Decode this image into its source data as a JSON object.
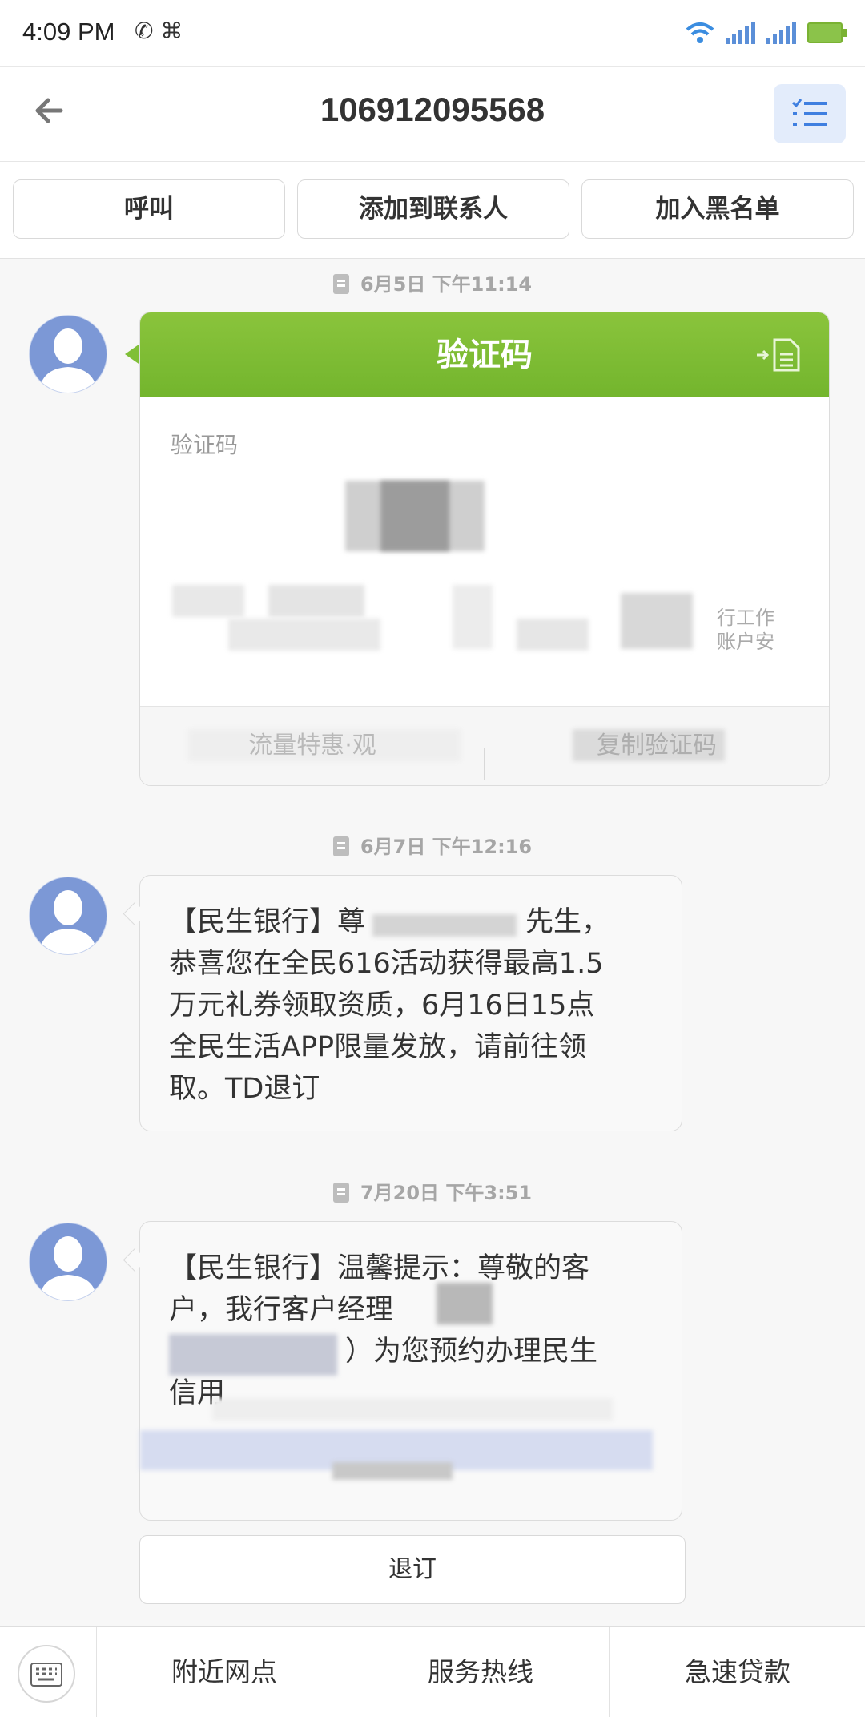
{
  "status_bar": {
    "time": "4:09 PM",
    "left_icons": "✆ ⌘"
  },
  "header": {
    "title": "106912095568"
  },
  "actions": {
    "call": "呼叫",
    "add_contact": "添加到联系人",
    "blacklist": "加入黑名单"
  },
  "messages": [
    {
      "date": "6月5日 下午11:14"
    },
    {
      "date": "6月7日 下午12:16"
    },
    {
      "date": "7月20日 下午3:51"
    }
  ],
  "card": {
    "title": "验证码",
    "body_label": "验证码",
    "side_text_1": "行工作",
    "side_text_2": "账户安",
    "footer_left": "流量特惠·观",
    "footer_right": "复制验证码"
  },
  "message2": {
    "line1_prefix": "【民生银行】尊",
    "line1_suffix": "先生，",
    "line2": "恭喜您在全民616活动获得最高1.5",
    "line3": "万元礼券领取资质，6月16日15点",
    "line4": "全民生活APP限量发放，请前往领",
    "line5": "取。TD退订"
  },
  "message3": {
    "line1": "【民生银行】温馨提示：尊敬的客",
    "line2": "户，我行客户经理",
    "line3": "）为您预约办理民生",
    "line4": "信用"
  },
  "unsubscribe": "退订",
  "bottom_bar": {
    "item1": "附近网点",
    "item2": "服务热线",
    "item3": "急速贷款"
  }
}
